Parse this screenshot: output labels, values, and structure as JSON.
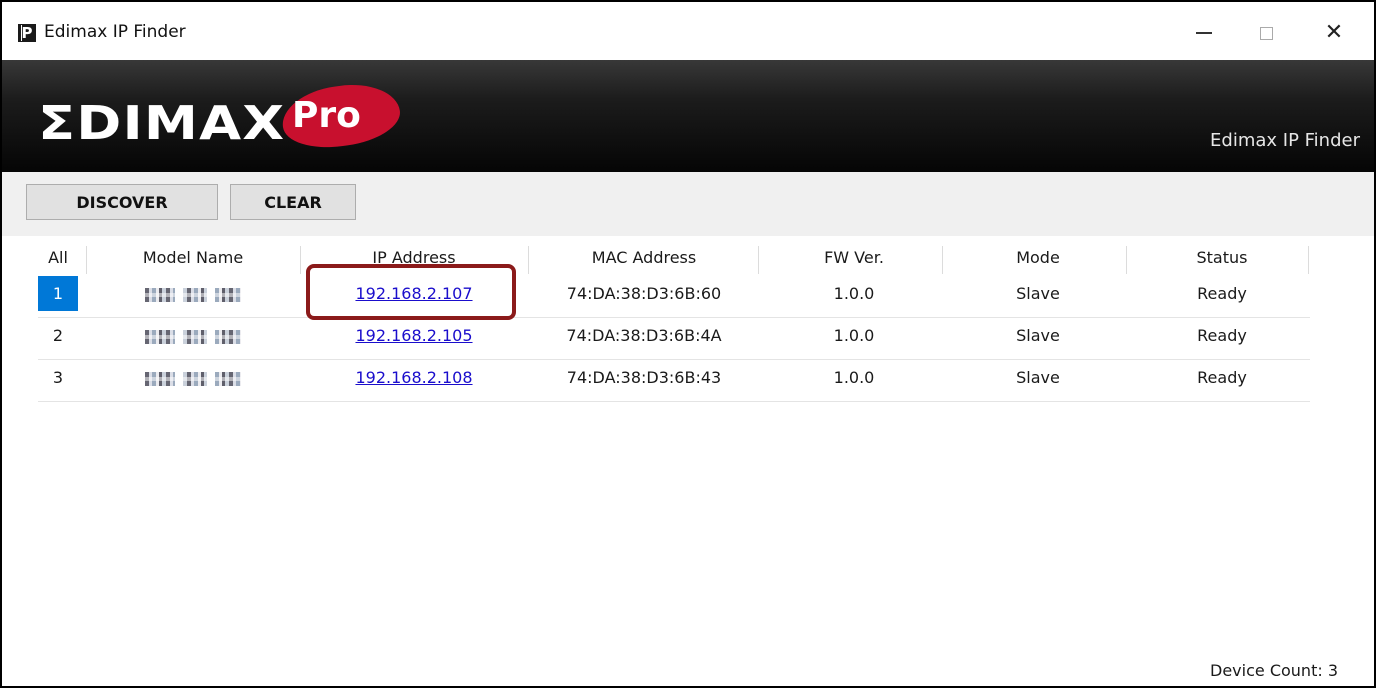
{
  "window": {
    "title": "Edimax IP Finder"
  },
  "banner": {
    "logo_text": "ΣDIMAX",
    "logo_badge": "Pro",
    "subtitle": "Edimax IP Finder"
  },
  "toolbar": {
    "discover_label": "DISCOVER",
    "clear_label": "CLEAR"
  },
  "table": {
    "columns": [
      "All",
      "Model Name",
      "IP Address",
      "MAC Address",
      "FW Ver.",
      "Mode",
      "Status"
    ],
    "rows": [
      {
        "index": "1",
        "ip": "192.168.2.107",
        "mac": "74:DA:38:D3:6B:60",
        "fw": "1.0.0",
        "mode": "Slave",
        "status": "Ready",
        "selected": true
      },
      {
        "index": "2",
        "ip": "192.168.2.105",
        "mac": "74:DA:38:D3:6B:4A",
        "fw": "1.0.0",
        "mode": "Slave",
        "status": "Ready",
        "selected": false
      },
      {
        "index": "3",
        "ip": "192.168.2.108",
        "mac": "74:DA:38:D3:6B:43",
        "fw": "1.0.0",
        "mode": "Slave",
        "status": "Ready",
        "selected": false
      }
    ]
  },
  "footer": {
    "device_count": "Device Count: 3"
  },
  "colors": {
    "selection": "#0078d7",
    "link": "#1a0dcc",
    "highlight": "#8b1a1a",
    "brand_red": "#c8102e"
  }
}
